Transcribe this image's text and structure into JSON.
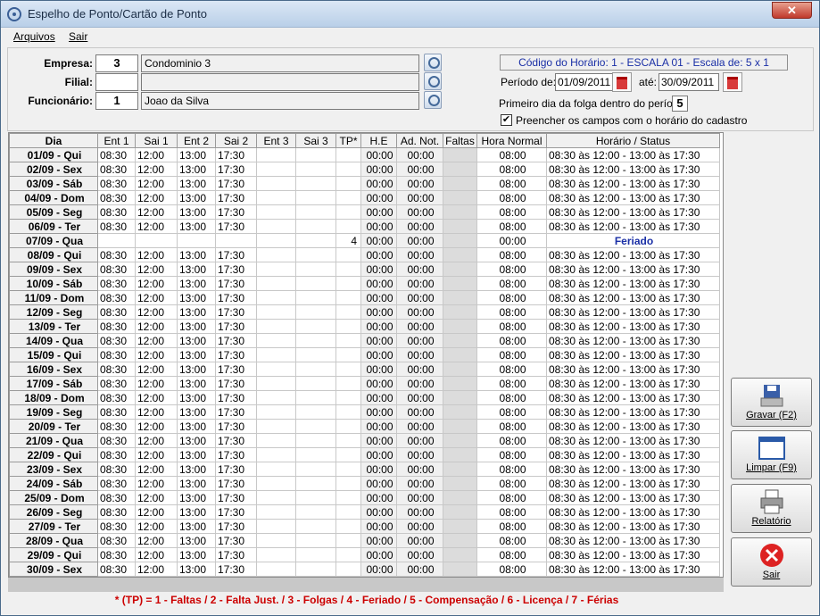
{
  "window": {
    "title": "Espelho de Ponto/Cartão de Ponto",
    "close": "✕"
  },
  "menu": [
    "Arquivos",
    "Sair"
  ],
  "form": {
    "empresa_label": "Empresa:",
    "empresa_code": "3",
    "empresa_name": "Condominio 3",
    "filial_label": "Filial:",
    "filial_code": "",
    "filial_name": "",
    "funcionario_label": "Funcionário:",
    "funcionario_code": "1",
    "funcionario_name": "Joao da Silva",
    "schedule": "Código do Horário: 1 - ESCALA 01 - Escala de: 5 x 1",
    "periodo_label": "Período de:",
    "periodo_de": "01/09/2011",
    "ate_label": "até:",
    "periodo_ate": "30/09/2011",
    "folga_label": "Primeiro dia da folga dentro do período:",
    "folga_value": "5",
    "checkbox_label": "Preencher os campos com o horário do cadastro",
    "checkbox_checked": "✔"
  },
  "table": {
    "headers": [
      "Dia",
      "Ent 1",
      "Sai 1",
      "Ent 2",
      "Sai 2",
      "Ent 3",
      "Sai 3",
      "TP*",
      "H.E",
      "Ad. Not.",
      "Faltas",
      "Hora Normal",
      "Horário  / Status"
    ],
    "rows": [
      {
        "dia": "01/09 - Qui",
        "e1": "08:30",
        "s1": "12:00",
        "e2": "13:00",
        "s2": "17:30",
        "tp": "",
        "he": "00:00",
        "an": "00:00",
        "hn": "08:00",
        "status": "08:30 às 12:00 - 13:00 às 17:30"
      },
      {
        "dia": "02/09 - Sex",
        "e1": "08:30",
        "s1": "12:00",
        "e2": "13:00",
        "s2": "17:30",
        "tp": "",
        "he": "00:00",
        "an": "00:00",
        "hn": "08:00",
        "status": "08:30 às 12:00 - 13:00 às 17:30"
      },
      {
        "dia": "03/09 - Sáb",
        "e1": "08:30",
        "s1": "12:00",
        "e2": "13:00",
        "s2": "17:30",
        "tp": "",
        "he": "00:00",
        "an": "00:00",
        "hn": "08:00",
        "status": "08:30 às 12:00 - 13:00 às 17:30"
      },
      {
        "dia": "04/09 - Dom",
        "e1": "08:30",
        "s1": "12:00",
        "e2": "13:00",
        "s2": "17:30",
        "tp": "",
        "he": "00:00",
        "an": "00:00",
        "hn": "08:00",
        "status": "08:30 às 12:00 - 13:00 às 17:30"
      },
      {
        "dia": "05/09 - Seg",
        "e1": "08:30",
        "s1": "12:00",
        "e2": "13:00",
        "s2": "17:30",
        "tp": "",
        "he": "00:00",
        "an": "00:00",
        "hn": "08:00",
        "status": "08:30 às 12:00 - 13:00 às 17:30"
      },
      {
        "dia": "06/09 - Ter",
        "e1": "08:30",
        "s1": "12:00",
        "e2": "13:00",
        "s2": "17:30",
        "tp": "",
        "he": "00:00",
        "an": "00:00",
        "hn": "08:00",
        "status": "08:30 às 12:00 - 13:00 às 17:30"
      },
      {
        "dia": "07/09 - Qua",
        "e1": "",
        "s1": "",
        "e2": "",
        "s2": "",
        "tp": "4",
        "he": "00:00",
        "an": "00:00",
        "hn": "00:00",
        "status": "Feriado",
        "holiday": true
      },
      {
        "dia": "08/09 - Qui",
        "e1": "08:30",
        "s1": "12:00",
        "e2": "13:00",
        "s2": "17:30",
        "tp": "",
        "he": "00:00",
        "an": "00:00",
        "hn": "08:00",
        "status": "08:30 às 12:00 - 13:00 às 17:30"
      },
      {
        "dia": "09/09 - Sex",
        "e1": "08:30",
        "s1": "12:00",
        "e2": "13:00",
        "s2": "17:30",
        "tp": "",
        "he": "00:00",
        "an": "00:00",
        "hn": "08:00",
        "status": "08:30 às 12:00 - 13:00 às 17:30"
      },
      {
        "dia": "10/09 - Sáb",
        "e1": "08:30",
        "s1": "12:00",
        "e2": "13:00",
        "s2": "17:30",
        "tp": "",
        "he": "00:00",
        "an": "00:00",
        "hn": "08:00",
        "status": "08:30 às 12:00 - 13:00 às 17:30"
      },
      {
        "dia": "11/09 - Dom",
        "e1": "08:30",
        "s1": "12:00",
        "e2": "13:00",
        "s2": "17:30",
        "tp": "",
        "he": "00:00",
        "an": "00:00",
        "hn": "08:00",
        "status": "08:30 às 12:00 - 13:00 às 17:30"
      },
      {
        "dia": "12/09 - Seg",
        "e1": "08:30",
        "s1": "12:00",
        "e2": "13:00",
        "s2": "17:30",
        "tp": "",
        "he": "00:00",
        "an": "00:00",
        "hn": "08:00",
        "status": "08:30 às 12:00 - 13:00 às 17:30"
      },
      {
        "dia": "13/09 - Ter",
        "e1": "08:30",
        "s1": "12:00",
        "e2": "13:00",
        "s2": "17:30",
        "tp": "",
        "he": "00:00",
        "an": "00:00",
        "hn": "08:00",
        "status": "08:30 às 12:00 - 13:00 às 17:30"
      },
      {
        "dia": "14/09 - Qua",
        "e1": "08:30",
        "s1": "12:00",
        "e2": "13:00",
        "s2": "17:30",
        "tp": "",
        "he": "00:00",
        "an": "00:00",
        "hn": "08:00",
        "status": "08:30 às 12:00 - 13:00 às 17:30"
      },
      {
        "dia": "15/09 - Qui",
        "e1": "08:30",
        "s1": "12:00",
        "e2": "13:00",
        "s2": "17:30",
        "tp": "",
        "he": "00:00",
        "an": "00:00",
        "hn": "08:00",
        "status": "08:30 às 12:00 - 13:00 às 17:30"
      },
      {
        "dia": "16/09 - Sex",
        "e1": "08:30",
        "s1": "12:00",
        "e2": "13:00",
        "s2": "17:30",
        "tp": "",
        "he": "00:00",
        "an": "00:00",
        "hn": "08:00",
        "status": "08:30 às 12:00 - 13:00 às 17:30"
      },
      {
        "dia": "17/09 - Sáb",
        "e1": "08:30",
        "s1": "12:00",
        "e2": "13:00",
        "s2": "17:30",
        "tp": "",
        "he": "00:00",
        "an": "00:00",
        "hn": "08:00",
        "status": "08:30 às 12:00 - 13:00 às 17:30"
      },
      {
        "dia": "18/09 - Dom",
        "e1": "08:30",
        "s1": "12:00",
        "e2": "13:00",
        "s2": "17:30",
        "tp": "",
        "he": "00:00",
        "an": "00:00",
        "hn": "08:00",
        "status": "08:30 às 12:00 - 13:00 às 17:30"
      },
      {
        "dia": "19/09 - Seg",
        "e1": "08:30",
        "s1": "12:00",
        "e2": "13:00",
        "s2": "17:30",
        "tp": "",
        "he": "00:00",
        "an": "00:00",
        "hn": "08:00",
        "status": "08:30 às 12:00 - 13:00 às 17:30"
      },
      {
        "dia": "20/09 - Ter",
        "e1": "08:30",
        "s1": "12:00",
        "e2": "13:00",
        "s2": "17:30",
        "tp": "",
        "he": "00:00",
        "an": "00:00",
        "hn": "08:00",
        "status": "08:30 às 12:00 - 13:00 às 17:30"
      },
      {
        "dia": "21/09 - Qua",
        "e1": "08:30",
        "s1": "12:00",
        "e2": "13:00",
        "s2": "17:30",
        "tp": "",
        "he": "00:00",
        "an": "00:00",
        "hn": "08:00",
        "status": "08:30 às 12:00 - 13:00 às 17:30"
      },
      {
        "dia": "22/09 - Qui",
        "e1": "08:30",
        "s1": "12:00",
        "e2": "13:00",
        "s2": "17:30",
        "tp": "",
        "he": "00:00",
        "an": "00:00",
        "hn": "08:00",
        "status": "08:30 às 12:00 - 13:00 às 17:30"
      },
      {
        "dia": "23/09 - Sex",
        "e1": "08:30",
        "s1": "12:00",
        "e2": "13:00",
        "s2": "17:30",
        "tp": "",
        "he": "00:00",
        "an": "00:00",
        "hn": "08:00",
        "status": "08:30 às 12:00 - 13:00 às 17:30"
      },
      {
        "dia": "24/09 - Sáb",
        "e1": "08:30",
        "s1": "12:00",
        "e2": "13:00",
        "s2": "17:30",
        "tp": "",
        "he": "00:00",
        "an": "00:00",
        "hn": "08:00",
        "status": "08:30 às 12:00 - 13:00 às 17:30"
      },
      {
        "dia": "25/09 - Dom",
        "e1": "08:30",
        "s1": "12:00",
        "e2": "13:00",
        "s2": "17:30",
        "tp": "",
        "he": "00:00",
        "an": "00:00",
        "hn": "08:00",
        "status": "08:30 às 12:00 - 13:00 às 17:30"
      },
      {
        "dia": "26/09 - Seg",
        "e1": "08:30",
        "s1": "12:00",
        "e2": "13:00",
        "s2": "17:30",
        "tp": "",
        "he": "00:00",
        "an": "00:00",
        "hn": "08:00",
        "status": "08:30 às 12:00 - 13:00 às 17:30"
      },
      {
        "dia": "27/09 - Ter",
        "e1": "08:30",
        "s1": "12:00",
        "e2": "13:00",
        "s2": "17:30",
        "tp": "",
        "he": "00:00",
        "an": "00:00",
        "hn": "08:00",
        "status": "08:30 às 12:00 - 13:00 às 17:30"
      },
      {
        "dia": "28/09 - Qua",
        "e1": "08:30",
        "s1": "12:00",
        "e2": "13:00",
        "s2": "17:30",
        "tp": "",
        "he": "00:00",
        "an": "00:00",
        "hn": "08:00",
        "status": "08:30 às 12:00 - 13:00 às 17:30"
      },
      {
        "dia": "29/09 - Qui",
        "e1": "08:30",
        "s1": "12:00",
        "e2": "13:00",
        "s2": "17:30",
        "tp": "",
        "he": "00:00",
        "an": "00:00",
        "hn": "08:00",
        "status": "08:30 às 12:00 - 13:00 às 17:30"
      },
      {
        "dia": "30/09 - Sex",
        "e1": "08:30",
        "s1": "12:00",
        "e2": "13:00",
        "s2": "17:30",
        "tp": "",
        "he": "00:00",
        "an": "00:00",
        "hn": "08:00",
        "status": "08:30 às 12:00 - 13:00 às 17:30"
      }
    ]
  },
  "legend": "* (TP) = 1 - Faltas  /  2 - Falta Just.  /  3 - Folgas  /  4 - Feriado  /  5 - Compensação  /  6 - Licença  /  7 - Férias",
  "buttons": {
    "gravar": "Gravar (F2)",
    "limpar": "Limpar (F9)",
    "relatorio": "Relatório",
    "sair": "Sair"
  },
  "colors": {
    "holiday": "#1a2fa6",
    "legend": "#cc0000",
    "schedule": "#1a2fa6"
  }
}
